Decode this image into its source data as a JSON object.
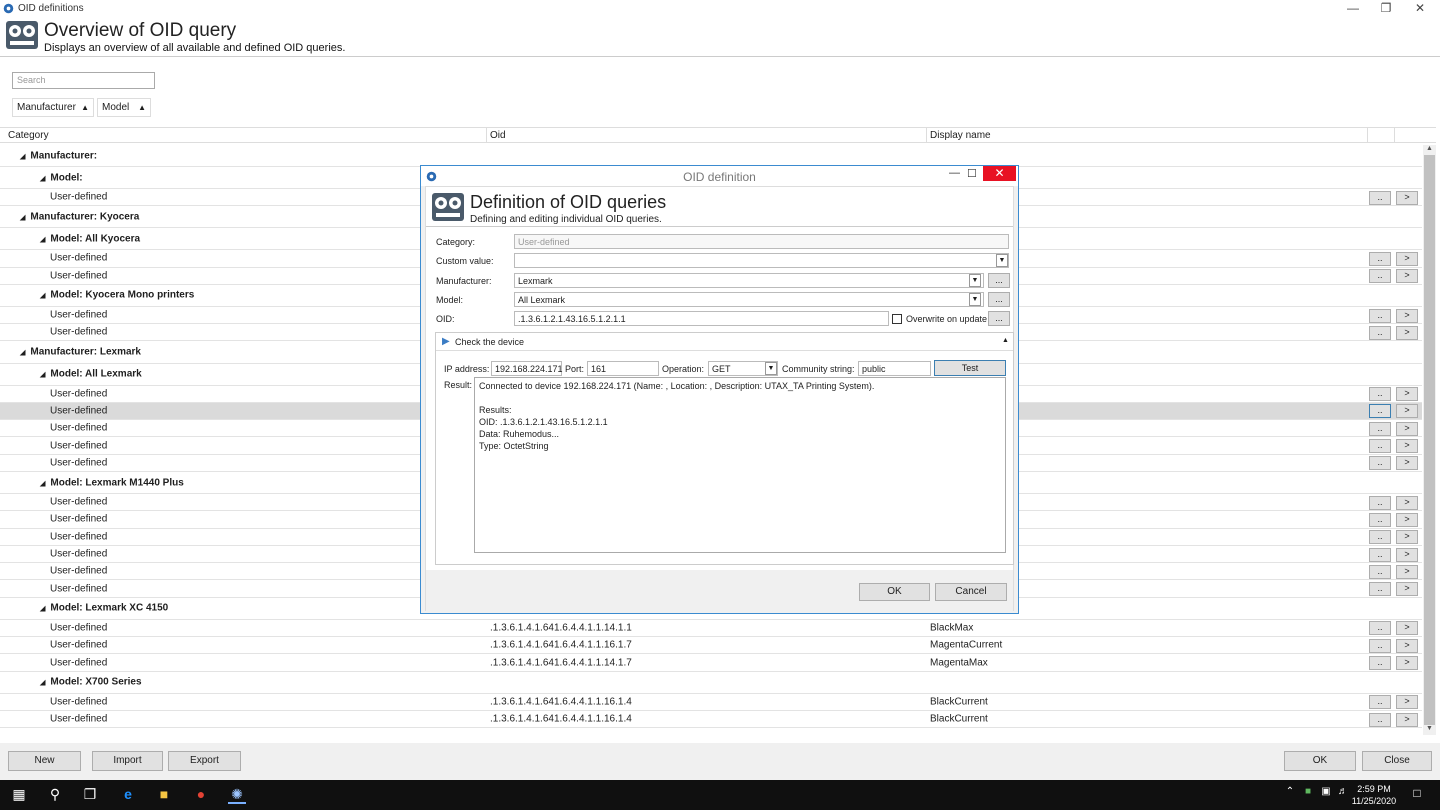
{
  "window": {
    "title": "OID definitions"
  },
  "header": {
    "title": "Overview of OID query",
    "subtitle": "Displays an overview of all available and defined OID queries."
  },
  "search": {
    "placeholder": "Search"
  },
  "filters": [
    {
      "label": "Manufacturer"
    },
    {
      "label": "Model"
    }
  ],
  "columns": {
    "category": "Category",
    "oid": "Oid",
    "display_name": "Display name"
  },
  "rows": [
    {
      "type": "group",
      "label": "Manufacturer:"
    },
    {
      "type": "subgroup",
      "label": "Model:"
    },
    {
      "type": "item",
      "label": "User-defined",
      "oid": "",
      "name": ""
    },
    {
      "type": "group",
      "label": "Manufacturer: Kyocera"
    },
    {
      "type": "subgroup",
      "label": "Model: All Kyocera"
    },
    {
      "type": "item",
      "label": "User-defined",
      "oid": "",
      "name": ""
    },
    {
      "type": "item",
      "label": "User-defined",
      "oid": "",
      "name": ""
    },
    {
      "type": "subgroup",
      "label": "Model: Kyocera Mono printers"
    },
    {
      "type": "item",
      "label": "User-defined",
      "oid": "",
      "name": ""
    },
    {
      "type": "item",
      "label": "User-defined",
      "oid": "",
      "name": ""
    },
    {
      "type": "group",
      "label": "Manufacturer: Lexmark"
    },
    {
      "type": "subgroup",
      "label": "Model: All Lexmark"
    },
    {
      "type": "item",
      "label": "User-defined",
      "oid": "",
      "name": ""
    },
    {
      "type": "item",
      "label": "User-defined",
      "oid": "",
      "name": "",
      "selected": true
    },
    {
      "type": "item",
      "label": "User-defined",
      "oid": "",
      "name": ""
    },
    {
      "type": "item",
      "label": "User-defined",
      "oid": "",
      "name": ""
    },
    {
      "type": "item",
      "label": "User-defined",
      "oid": "",
      "name": ""
    },
    {
      "type": "subgroup",
      "label": "Model: Lexmark M1440 Plus"
    },
    {
      "type": "item",
      "label": "User-defined",
      "oid": "",
      "name": ""
    },
    {
      "type": "item",
      "label": "User-defined",
      "oid": "",
      "name": ""
    },
    {
      "type": "item",
      "label": "User-defined",
      "oid": "",
      "name": ""
    },
    {
      "type": "item",
      "label": "User-defined",
      "oid": "",
      "name": ""
    },
    {
      "type": "item",
      "label": "User-defined",
      "oid": "",
      "name": ""
    },
    {
      "type": "item",
      "label": "User-defined",
      "oid": "",
      "name": ""
    },
    {
      "type": "subgroup",
      "label": "Model: Lexmark XC 4150"
    },
    {
      "type": "item",
      "label": "User-defined",
      "oid": ".1.3.6.1.4.1.641.6.4.4.1.1.14.1.1",
      "name": "BlackMax"
    },
    {
      "type": "item",
      "label": "User-defined",
      "oid": ".1.3.6.1.4.1.641.6.4.4.1.1.16.1.7",
      "name": "MagentaCurrent"
    },
    {
      "type": "item",
      "label": "User-defined",
      "oid": ".1.3.6.1.4.1.641.6.4.4.1.1.14.1.7",
      "name": "MagentaMax"
    },
    {
      "type": "subgroup",
      "label": "Model: X700 Series"
    },
    {
      "type": "item",
      "label": "User-defined",
      "oid": ".1.3.6.1.4.1.641.6.4.4.1.1.16.1.4",
      "name": "BlackCurrent"
    },
    {
      "type": "item",
      "label": "User-defined",
      "oid": ".1.3.6.1.4.1.641.6.4.4.1.1.16.1.4",
      "name": "BlackCurrent"
    }
  ],
  "row_buttons": {
    "edit": "..",
    "open": ">"
  },
  "bottom": {
    "new": "New",
    "import": "Import",
    "export": "Export",
    "ok": "OK",
    "close": "Close"
  },
  "dialog": {
    "window_title": "OID definition",
    "title": "Definition of OID queries",
    "subtitle": "Defining and editing individual OID queries.",
    "category_label": "Category:",
    "category_value": "User-defined",
    "custom_label": "Custom value:",
    "custom_value": "",
    "manufacturer_label": "Manufacturer:",
    "manufacturer_value": "Lexmark",
    "model_label": "Model:",
    "model_value": "All Lexmark",
    "oid_label": "OID:",
    "oid_value": ".1.3.6.1.2.1.43.16.5.1.2.1.1",
    "overwrite_label": "Overwrite on update",
    "ellipsis": "...",
    "check_label": "Check the device",
    "ip_label": "IP address:",
    "ip_value": "192.168.224.171",
    "port_label": "Port:",
    "port_value": "161",
    "operation_label": "Operation:",
    "operation_value": "GET",
    "community_label": "Community string:",
    "community_value": "public",
    "test_label": "Test",
    "result_label": "Result:",
    "result_lines": [
      "Connected to device 192.168.224.171 (Name: , Location: , Description: UTAX_TA Printing System).",
      "",
      "Results:",
      "OID: .1.3.6.1.2.1.43.16.5.1.2.1.1",
      "Data: Ruhemodus...",
      "Type: OctetString"
    ],
    "ok": "OK",
    "cancel": "Cancel"
  },
  "taskbar": {
    "time": "2:59 PM",
    "date": "11/25/2020"
  },
  "colors": {
    "accent": "#3b8bd0",
    "close_red": "#e81123",
    "selected_row": "#dadada"
  }
}
